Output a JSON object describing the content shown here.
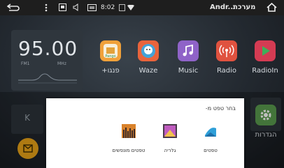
{
  "statusbar": {
    "back_icon": "back-arrow-icon",
    "menu_icon": "vertical-dots-icon",
    "time": "8:02",
    "app_title": "Andr...",
    "title_he": "מערכת",
    "home_icon": "home-icon"
  },
  "radio_widget": {
    "frequency": "95.00",
    "band": "FM1",
    "unit": "MHz",
    "side_label": "K"
  },
  "apps": [
    {
      "label": "פנגו+",
      "icon": "pango-icon",
      "color": "#f0a13a"
    },
    {
      "label": "Waze",
      "icon": "waze-icon",
      "color": "#e9643c"
    },
    {
      "label": "Music",
      "icon": "music-note-icon",
      "color": "#8f63c8"
    },
    {
      "label": "Radio",
      "icon": "radio-icon",
      "color": "#e0523f"
    },
    {
      "label": "RadioIn",
      "icon": "play-icon",
      "color": "#d43b53"
    }
  ],
  "settings_app": {
    "label": "הגדרות",
    "icon": "gear-icon",
    "color": "#5a9b4e"
  },
  "dialog": {
    "title": "בחר טפט מ-",
    "options": [
      {
        "label": "טפטים מונפשים",
        "icon": "live-wallpaper-icon"
      },
      {
        "label": "גלריה",
        "icon": "gallery-icon"
      },
      {
        "label": "טפטים",
        "icon": "wallpaper-icon"
      }
    ]
  }
}
